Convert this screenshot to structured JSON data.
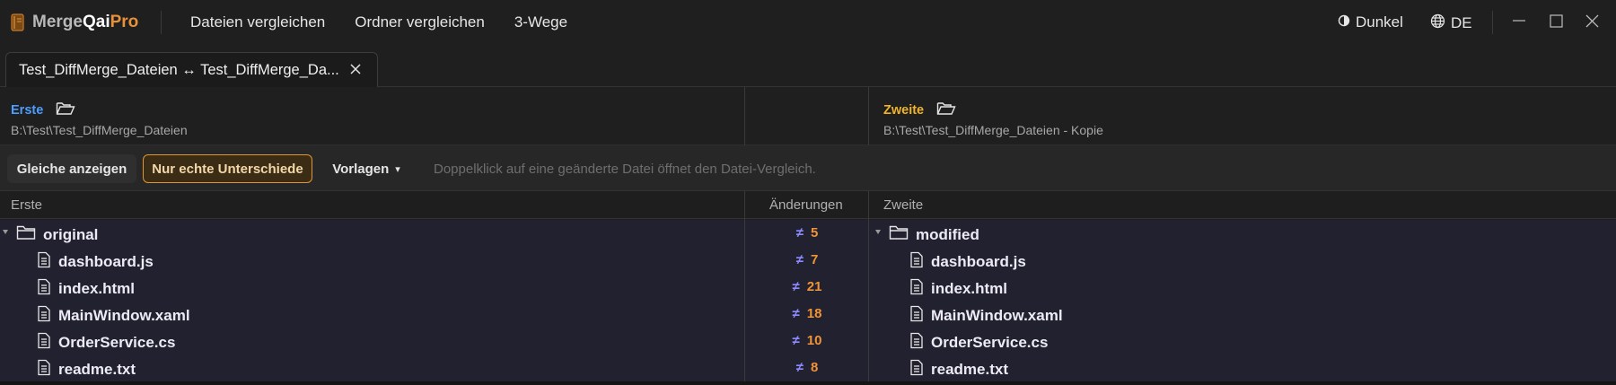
{
  "app": {
    "logo_icon": "book-icon",
    "name_merge": "Merge",
    "name_qai": "Qai",
    "name_pro": "Pro",
    "brand_color": "#e8913a"
  },
  "menu": {
    "items": [
      "Dateien vergleichen",
      "Ordner vergleichen",
      "3-Wege"
    ]
  },
  "titlebar_right": {
    "theme_label": "Dunkel",
    "theme_icon": "half-circle-icon",
    "language_label": "DE",
    "language_icon": "globe-icon"
  },
  "window_controls": [
    "minimize-icon",
    "maximize-icon",
    "close-icon"
  ],
  "tab": {
    "label": "Test_DiffMerge_Dateien ↔ Test_DiffMerge_Da...",
    "close_icon": "close-icon"
  },
  "panes": {
    "left": {
      "label": "Erste",
      "label_color": "#4c9dff",
      "icon": "folder-open-icon",
      "path": "B:\\Test\\Test_DiffMerge_Dateien"
    },
    "right": {
      "label": "Zweite",
      "label_color": "#f0b429",
      "icon": "folder-open-icon",
      "path": "B:\\Test\\Test_DiffMerge_Dateien - Kopie"
    }
  },
  "toolbar": {
    "show_equal_label": "Gleiche anzeigen",
    "only_diffs_label": "Nur echte Unterschiede",
    "templates_label": "Vorlagen",
    "templates_caret": "▾",
    "hint": "Doppelklick auf eine geänderte Datei öffnet den Datei-Vergleich."
  },
  "columns": {
    "left": "Erste",
    "changes": "Änderungen",
    "right": "Zweite"
  },
  "tree": {
    "left_root": "original",
    "right_root": "modified",
    "root_changes": "5",
    "diff_symbol": "≠",
    "files": [
      {
        "left": "dashboard.js",
        "right": "dashboard.js",
        "changes": "7"
      },
      {
        "left": "index.html",
        "right": "index.html",
        "changes": "21"
      },
      {
        "left": "MainWindow.xaml",
        "right": "MainWindow.xaml",
        "changes": "18"
      },
      {
        "left": "OrderService.cs",
        "right": "OrderService.cs",
        "changes": "10"
      },
      {
        "left": "readme.txt",
        "right": "readme.txt",
        "changes": "8"
      }
    ]
  }
}
